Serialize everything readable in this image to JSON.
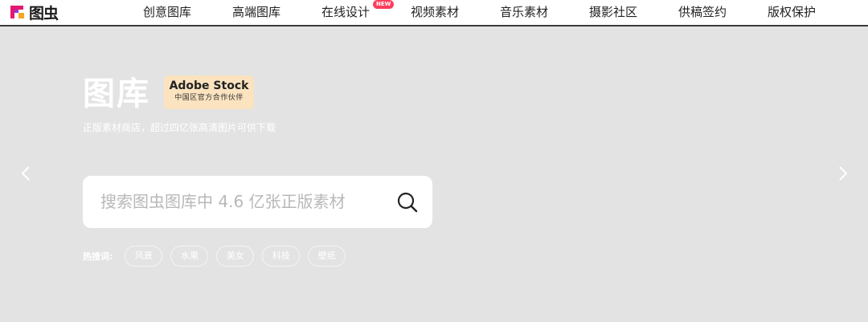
{
  "brand": {
    "logo_text": "图虫"
  },
  "nav": {
    "items": [
      "创意图库",
      "高端图库",
      "在线设计",
      "视频素材",
      "音乐素材",
      "摄影社区",
      "供稿签约",
      "版权保护"
    ],
    "new_badge": "NEW"
  },
  "hero": {
    "title": "图库",
    "badge_main": "Adobe Stock",
    "badge_sub": "中国区官方合作伙伴",
    "subtitle": "正版素材商店，超过四亿张高清图片可供下载"
  },
  "search": {
    "placeholder": "搜索图虫图库中 4.6 亿张正版素材",
    "value": ""
  },
  "hot": {
    "label": "热搜词:",
    "tags": [
      "风景",
      "水果",
      "美女",
      "科技",
      "壁纸"
    ]
  },
  "colors": {
    "accent_red": "#ff3d5a",
    "logo_magenta": "#e5176f",
    "logo_orange": "#f5a623",
    "badge_bg": "#fbe3bf",
    "hero_bg": "#e3e3e3"
  },
  "icons": {
    "logo": "tuchong-logo-icon",
    "search": "search-icon",
    "prev": "chevron-left-icon",
    "next": "chevron-right-icon"
  }
}
